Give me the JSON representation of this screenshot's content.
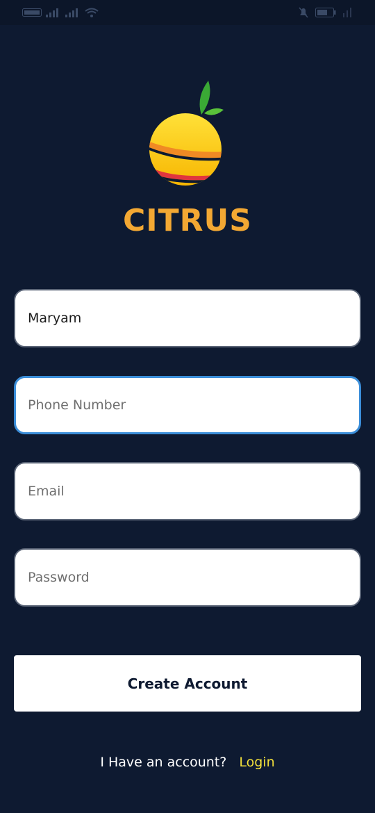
{
  "app": {
    "brand_name": "CITRUS"
  },
  "colors": {
    "background": "#0e1a31",
    "brand_orange": "#f3a833",
    "focus_blue": "#3b8ed9",
    "login_yellow": "#f3e03a"
  },
  "form": {
    "name_value": "Maryam",
    "phone_placeholder": "Phone Number",
    "email_placeholder": "Email",
    "password_placeholder": "Password",
    "submit_label": "Create Account"
  },
  "footer": {
    "question": "I Have an account?",
    "login_label": "Login"
  },
  "status_bar": {
    "icons": [
      "volte-icon",
      "signal-icon",
      "signal-icon",
      "wifi-icon",
      "mute-icon",
      "battery-icon"
    ]
  }
}
